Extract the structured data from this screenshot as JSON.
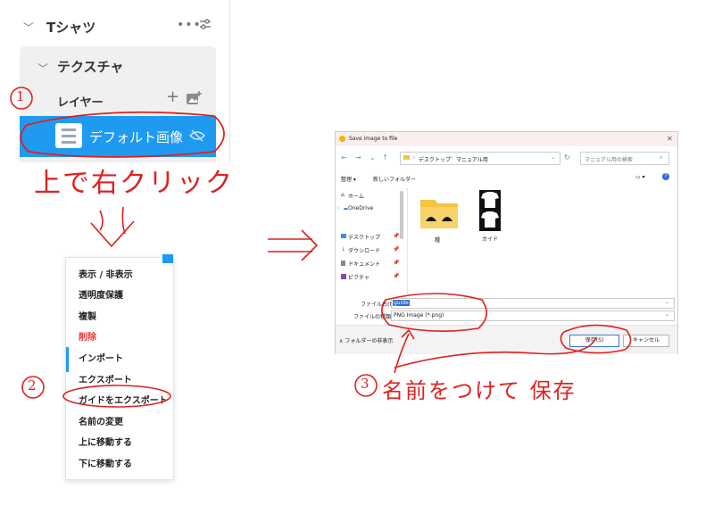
{
  "layer_panel": {
    "group_title": "Tシャツ",
    "texture_title": "テクスチャ",
    "layer_title": "レイヤー",
    "layer_item": "デフォルト画像"
  },
  "context_menu": {
    "items": [
      {
        "label": "表示 / 非表示"
      },
      {
        "label": "透明度保護"
      },
      {
        "label": "複製"
      },
      {
        "label": "削除"
      },
      {
        "label": "インポート"
      },
      {
        "label": "エクスポート"
      },
      {
        "label": "ガイドをエクスポート"
      },
      {
        "label": "名前の変更"
      },
      {
        "label": "上に移動する"
      },
      {
        "label": "下に移動する"
      }
    ]
  },
  "dialog": {
    "title": "Save image to file",
    "breadcrumb": [
      "デスクトップ",
      "マニュアル用"
    ],
    "search_placeholder": "マニュアル用の検索",
    "organize": "整理",
    "new_folder": "新しいフォルダー",
    "nav_items": [
      {
        "label": "ホーム",
        "pinned": false
      },
      {
        "label": "OneDrive",
        "pinned": false
      },
      {
        "label": "デスクトップ",
        "pinned": true
      },
      {
        "label": "ダウンロード",
        "pinned": true
      },
      {
        "label": "ドキュメント",
        "pinned": true
      },
      {
        "label": "ピクチャ",
        "pinned": true
      }
    ],
    "files": [
      {
        "name": "種",
        "type": "folder"
      },
      {
        "name": "ガイド",
        "type": "image"
      }
    ],
    "filename_label": "ファイル名(N):",
    "filename_value": "guide",
    "filetype_label": "ファイルの種類(T):",
    "filetype_value": "PNG Image (*.png)",
    "hide_folders": "フォルダーの非表示",
    "save_button": "保存(S)",
    "cancel_button": "キャンセル"
  },
  "annotations": {
    "step1_number": "1",
    "step1_text": "上で右クリック",
    "step2_number": "2",
    "step3_number": "3",
    "step3_text": "名前をつけて 保存"
  },
  "colors": {
    "accent_blue": "#1e9bf0",
    "annotation_red": "#e02020",
    "delete_red": "#e53935",
    "folder_yellow": "#f5c542"
  }
}
